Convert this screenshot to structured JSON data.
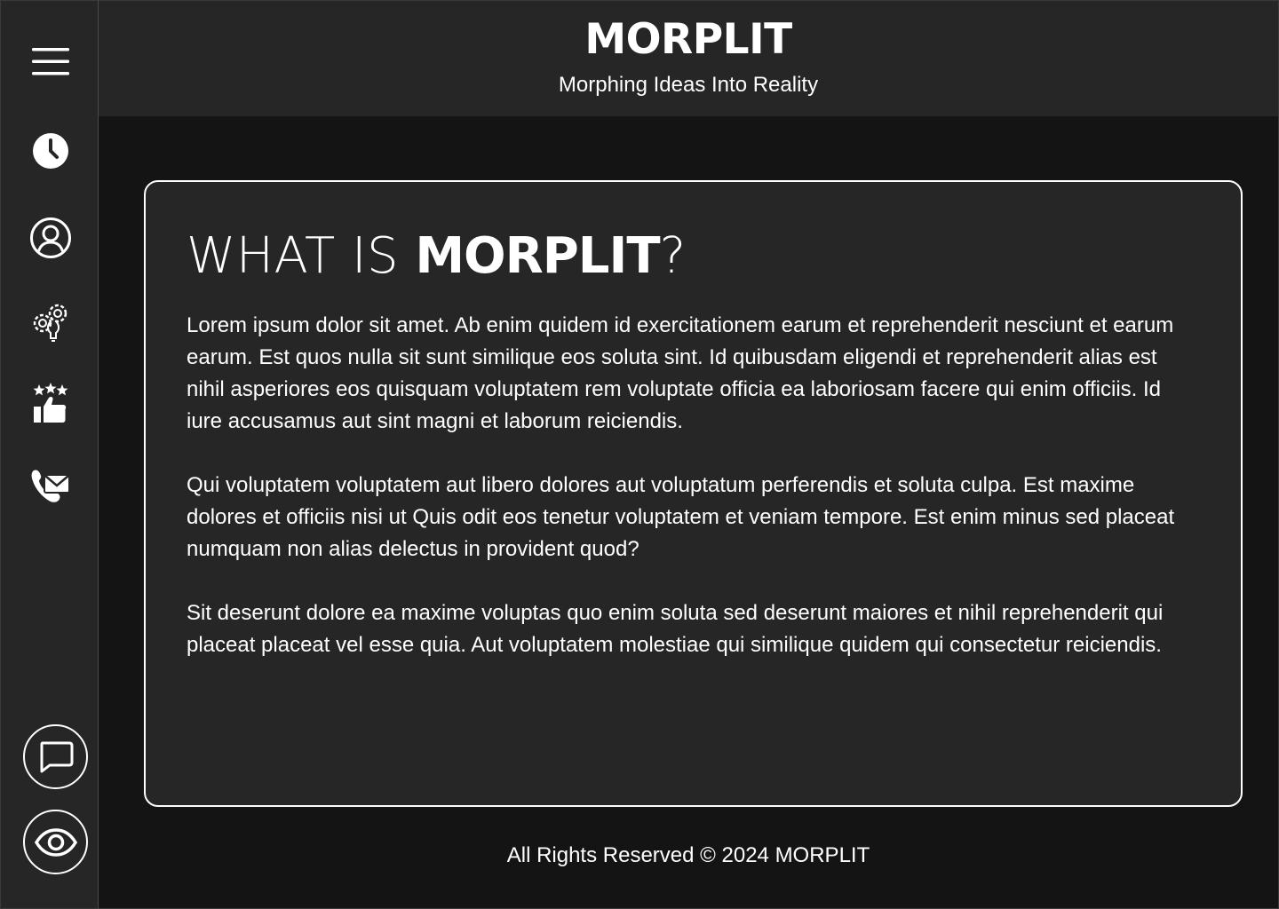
{
  "header": {
    "brand": "MORPLIT",
    "tagline": "Morphing Ideas Into Reality"
  },
  "sidebar": {
    "items": [
      {
        "icon": "menu-icon"
      },
      {
        "icon": "clock-icon"
      },
      {
        "icon": "user-circle-icon"
      },
      {
        "icon": "gear-bulb-icon"
      },
      {
        "icon": "thumbs-up-stars-icon"
      },
      {
        "icon": "phone-mail-icon"
      }
    ],
    "bottom_buttons": [
      {
        "icon": "chat-icon"
      },
      {
        "icon": "eye-icon"
      }
    ]
  },
  "card": {
    "title_prefix": "WHAT IS ",
    "title_brand": "MORPLIT",
    "title_suffix": "?",
    "paragraphs": [
      "Lorem ipsum dolor sit amet. Ab enim quidem id exercitationem earum et reprehenderit nesciunt et earum earum. Est quos nulla sit sunt similique eos soluta sint. Id quibusdam eligendi et reprehenderit alias est nihil asperiores eos quisquam voluptatem rem voluptate officia ea laboriosam facere qui enim officiis. Id iure accusamus aut sint magni et laborum reiciendis.",
      "Qui voluptatem voluptatem aut libero dolores aut voluptatum perferendis et soluta culpa. Est maxime dolores et officiis nisi ut Quis odit eos tenetur voluptatem et veniam tempore. Est enim minus sed placeat numquam non alias delectus in provident quod?",
      "Sit deserunt dolore ea maxime voluptas quo enim soluta sed deserunt maiores et nihil reprehenderit qui placeat placeat vel esse quia. Aut voluptatem molestiae qui similique quidem qui consectetur reiciendis."
    ]
  },
  "footer": {
    "text": "All Rights Reserved © 2024 MORPLIT"
  },
  "colors": {
    "background": "#141414",
    "panel": "#262626",
    "text": "#ffffff"
  }
}
